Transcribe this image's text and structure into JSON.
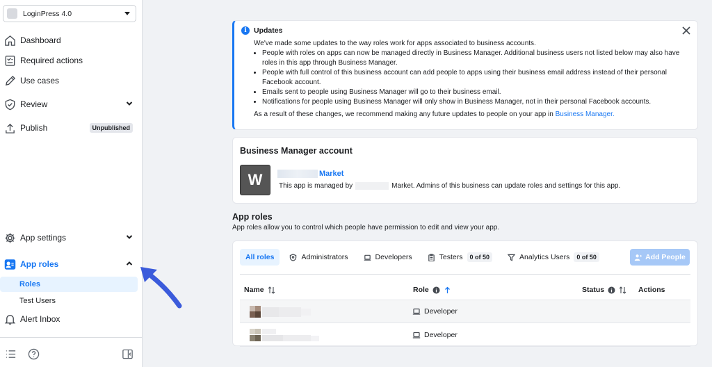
{
  "sidebar": {
    "app_name": "LoginPress 4.0",
    "items": [
      {
        "label": "Dashboard",
        "icon": "home-icon"
      },
      {
        "label": "Required actions",
        "icon": "checklist-icon"
      },
      {
        "label": "Use cases",
        "icon": "pencil-icon"
      },
      {
        "label": "Review",
        "icon": "shield-check-icon"
      },
      {
        "label": "Publish",
        "icon": "upload-icon",
        "badge": "Unpublished"
      },
      {
        "label": "App settings",
        "icon": "gear-icon"
      },
      {
        "label": "App roles",
        "icon": "people-icon"
      },
      {
        "label": "Alert Inbox",
        "icon": "bell-icon"
      }
    ],
    "sub_items": [
      {
        "label": "Roles"
      },
      {
        "label": "Test Users"
      }
    ]
  },
  "updates": {
    "title": "Updates",
    "intro": "We've made some updates to the way roles work for apps associated to business accounts.",
    "bullets": [
      "People with roles on apps can now be managed directly in Business Manager. Additional business users not listed below may also have roles in this app through Business Manager.",
      "People with full control of this business account can add people to apps using their business email address instead of their personal Facebook account.",
      "Emails sent to people using Business Manager will go to their business email.",
      "Notifications for people using Business Manager will only show in Business Manager, not in their personal Facebook accounts."
    ],
    "outro": "As a result of these changes, we recommend making any future updates to people on your app in ",
    "outro_link": "Business Manager."
  },
  "business_manager": {
    "title": "Business Manager account",
    "avatar_letter": "W",
    "name_suffix": "Market",
    "desc_prefix": "This app is managed by",
    "desc_suffix": "Market. Admins of this business can update roles and settings for this app."
  },
  "app_roles": {
    "title": "App roles",
    "subtitle": "App roles allow you to control which people have permission to edit and view your app.",
    "tabs": [
      {
        "label": "All roles"
      },
      {
        "label": "Administrators"
      },
      {
        "label": "Developers"
      },
      {
        "label": "Testers",
        "count": "0 of 50"
      },
      {
        "label": "Analytics Users",
        "count": "0 of 50"
      }
    ],
    "add_button": "Add People",
    "columns": [
      "Name",
      "Role",
      "Status",
      "Actions"
    ],
    "rows": [
      {
        "role": "Developer"
      },
      {
        "role": "Developer"
      }
    ]
  },
  "colors": {
    "accent": "#1877f2",
    "annotation_arrow": "#3b5bdb"
  }
}
